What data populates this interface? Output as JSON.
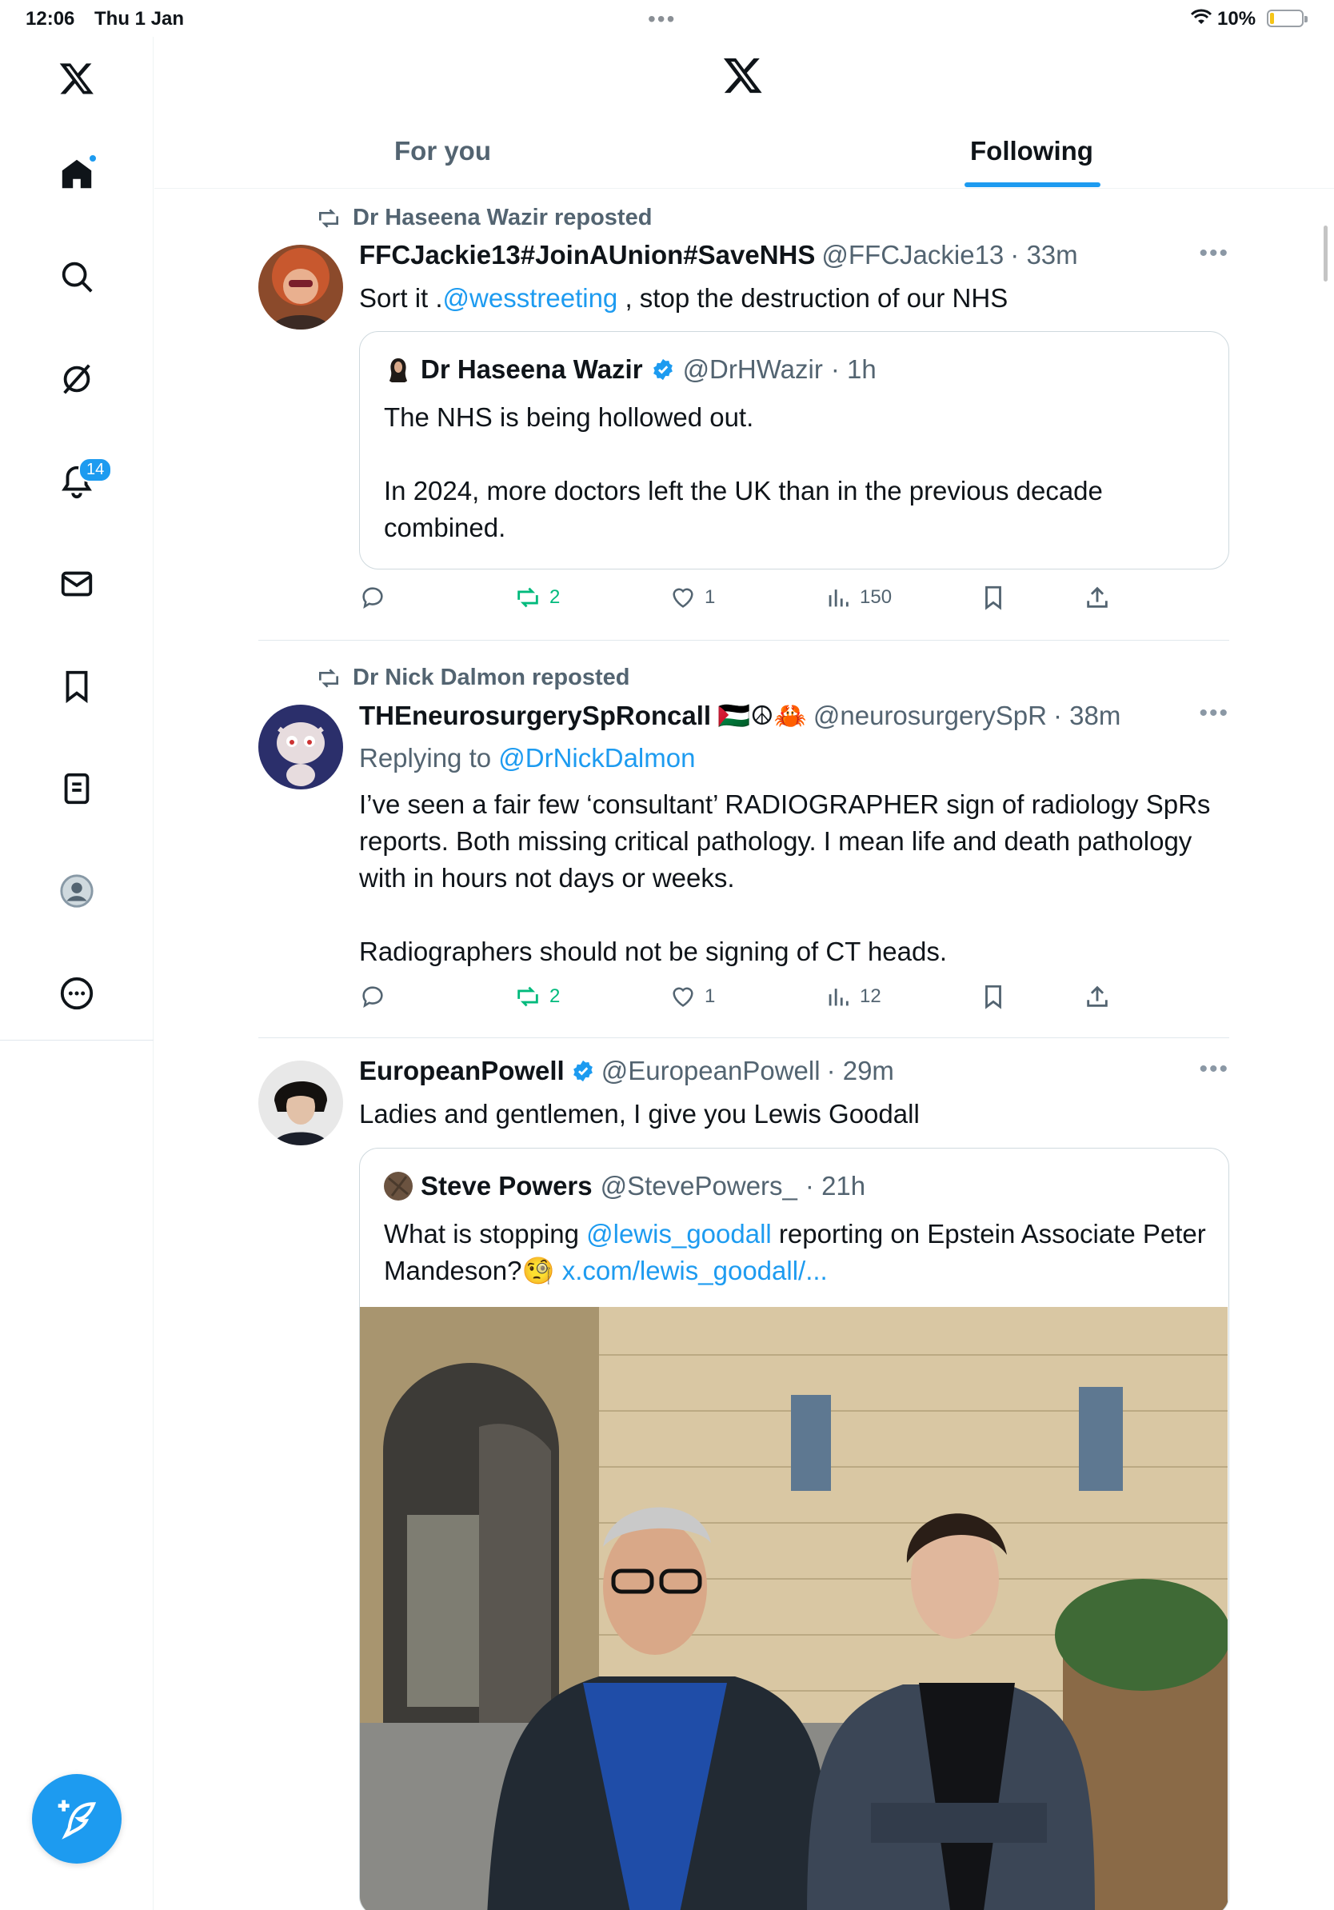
{
  "status_bar": {
    "time": "12:06",
    "date": "Thu 1 Jan",
    "battery": "10%"
  },
  "sidebar": {
    "notifications_count": "14"
  },
  "header": {
    "tabs": [
      {
        "label": "For you",
        "active": false
      },
      {
        "label": "Following",
        "active": true
      }
    ]
  },
  "colors": {
    "accent": "#1d9bf0",
    "retweet_green": "#00ba7c",
    "muted": "#536471"
  },
  "tweets": [
    {
      "repost_by": "Dr Haseena Wazir reposted",
      "name": "FFCJackie13#JoinAUnion#SaveNHS",
      "handle": "@FFCJackie13",
      "time": "· 33m",
      "text_prefix": "Sort it .",
      "text_link": "@wesstreeting",
      "text_suffix": " , stop the destruction of our NHS",
      "quote": {
        "name": "Dr Haseena Wazir",
        "handle": "@DrHWazir",
        "time": "· 1h",
        "text": "The NHS is being hollowed out.\n\nIn 2024, more doctors left the UK than in the previous decade combined."
      },
      "stats": {
        "retweets": "2",
        "likes": "1",
        "views": "150"
      }
    },
    {
      "repost_by": "Dr Nick Dalmon reposted",
      "name": "THEneurosurgerySpRoncall",
      "name_emoji": "🇵🇸☮🦀",
      "handle": "@neurosurgerySpR",
      "time": "· 38m",
      "reply_prefix": "Replying to ",
      "reply_to": "@DrNickDalmon",
      "text": "I’ve seen a fair few ‘consultant’ RADIOGRAPHER sign of radiology SpRs reports. Both missing critical pathology. I mean life and death pathology with in hours not days or weeks.\n\nRadiographers should not be signing of CT heads.",
      "stats": {
        "retweets": "2",
        "likes": "1",
        "views": "12"
      }
    },
    {
      "name": "EuropeanPowell",
      "handle": "@EuropeanPowell",
      "time": "· 29m",
      "text": "Ladies and gentlemen, I give you Lewis Goodall",
      "quote": {
        "name": "Steve Powers",
        "handle": "@StevePowers_",
        "time": "· 21h",
        "text_prefix": "What is stopping ",
        "text_link": "@lewis_goodall",
        "text_mid": " reporting on Epstein Associate Peter Mandeson?",
        "text_emoji": "🧐",
        "text_link2": " x.com/lewis_goodall/..."
      }
    }
  ]
}
